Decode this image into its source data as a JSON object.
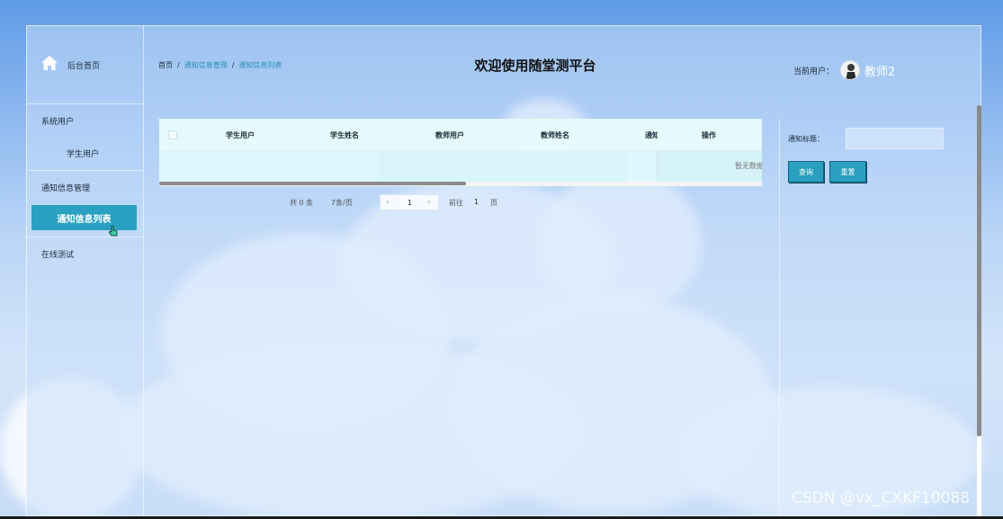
{
  "sidebar": {
    "home_label": "后台首页",
    "groups": [
      {
        "label": "系统用户",
        "items": [
          {
            "label": "学生用户"
          }
        ]
      },
      {
        "label": "通知信息管理",
        "items": [
          {
            "label": "通知信息列表",
            "active": true
          }
        ]
      },
      {
        "label": "在线测试",
        "items": []
      }
    ]
  },
  "header": {
    "breadcrumb": [
      "首页",
      "通知信息管理",
      "通知信息列表"
    ],
    "title": "欢迎使用随堂测平台",
    "current_user_label": "当前用户：",
    "user_name": "教师2"
  },
  "table": {
    "columns": [
      "学生用户",
      "学生姓名",
      "教师用户",
      "教师姓名",
      "通知",
      "操作"
    ],
    "empty_text": "暂无数据"
  },
  "pagination": {
    "total": "共 0 条",
    "page_size": "7条/页",
    "current_page": "1",
    "goto_prefix": "前往",
    "goto_value": "1",
    "goto_suffix": "页"
  },
  "search": {
    "label": "通知标题：",
    "value": "",
    "query_button": "查询",
    "reset_button": "重置"
  },
  "watermark": "CSDN @vx_CXKF10088",
  "colors": {
    "accent": "#2aa1c2",
    "button": "#2a9fc0"
  }
}
